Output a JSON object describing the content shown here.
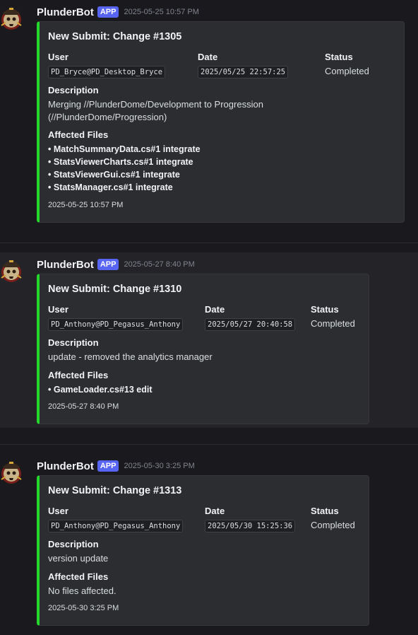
{
  "messages": [
    {
      "username": "PlunderBot",
      "badge": "APP",
      "timestamp": "2025-05-25 10:57 PM",
      "embed": {
        "title": "New Submit: Change #1305",
        "user_label": "User",
        "user_value": "PD_Bryce@PD_Desktop_Bryce",
        "date_label": "Date",
        "date_value": "2025/05/25 22:57:25",
        "status_label": "Status",
        "status_value": "Completed",
        "description_label": "Description",
        "description_line1": "Merging //PlunderDome/Development to Progression",
        "description_line2": "(//PlunderDome/Progression)",
        "files_label": "Affected Files",
        "files": [
          "MatchSummaryData.cs#1 integrate",
          "StatsViewerCharts.cs#1 integrate",
          "StatsViewerGui.cs#1 integrate",
          "StatsManager.cs#1 integrate"
        ],
        "footer": "2025-05-25 10:57 PM"
      }
    },
    {
      "username": "PlunderBot",
      "badge": "APP",
      "timestamp": "2025-05-27 8:40 PM",
      "embed": {
        "title": "New Submit: Change #1310",
        "user_label": "User",
        "user_value": "PD_Anthony@PD_Pegasus_Anthony",
        "date_label": "Date",
        "date_value": "2025/05/27 20:40:58",
        "status_label": "Status",
        "status_value": "Completed",
        "description_label": "Description",
        "description_line1": "update - removed the analytics manager",
        "files_label": "Affected Files",
        "files": [
          "GameLoader.cs#13 edit"
        ],
        "footer": "2025-05-27 8:40 PM"
      }
    },
    {
      "username": "PlunderBot",
      "badge": "APP",
      "timestamp": "2025-05-30 3:25 PM",
      "embed": {
        "title": "New Submit: Change #1313",
        "user_label": "User",
        "user_value": "PD_Anthony@PD_Pegasus_Anthony",
        "date_label": "Date",
        "date_value": "2025/05/30 15:25:36",
        "status_label": "Status",
        "status_value": "Completed",
        "description_label": "Description",
        "description_line1": "version update",
        "files_label": "Affected Files",
        "files_none": "No files affected.",
        "footer": "2025-05-30 3:25 PM"
      }
    }
  ],
  "colors": {
    "background": "#1a1a1e",
    "embed_background": "#2b2d31",
    "embed_accent": "#23d72b",
    "app_badge": "#5865f2"
  },
  "icons": {
    "avatar": "pirate-skull-avatar-icon"
  }
}
